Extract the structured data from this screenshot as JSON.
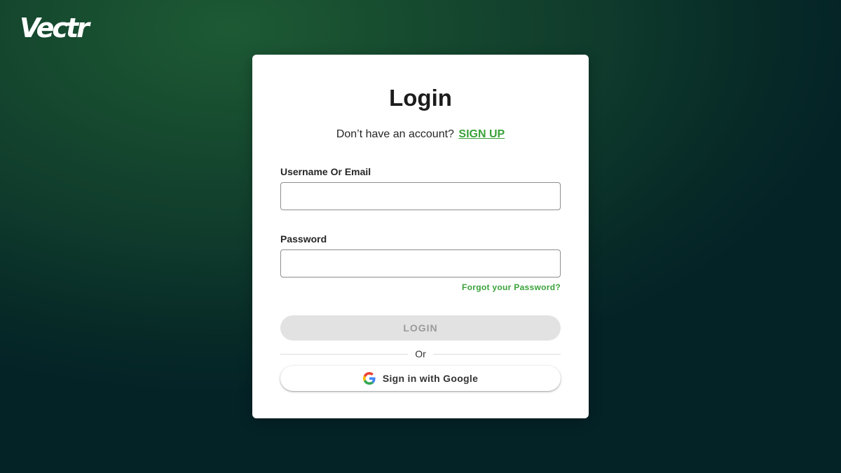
{
  "brand": {
    "logo_text": "Vectr"
  },
  "login": {
    "title": "Login",
    "no_account_text": "Don’t have an account?",
    "signup_label": "SIGN UP",
    "username_label": "Username Or Email",
    "username_value": "",
    "password_label": "Password",
    "password_value": "",
    "forgot_label": "Forgot your Password?",
    "login_button_label": "LOGIN",
    "divider_text": "Or",
    "google_button_label": "Sign in with Google"
  },
  "icons": {
    "google": "google-g-icon"
  },
  "colors": {
    "accent": "#3aa23a",
    "background_dark": "#042327",
    "background_green": "#1d5a34",
    "disabled_button": "#e2e2e2"
  }
}
